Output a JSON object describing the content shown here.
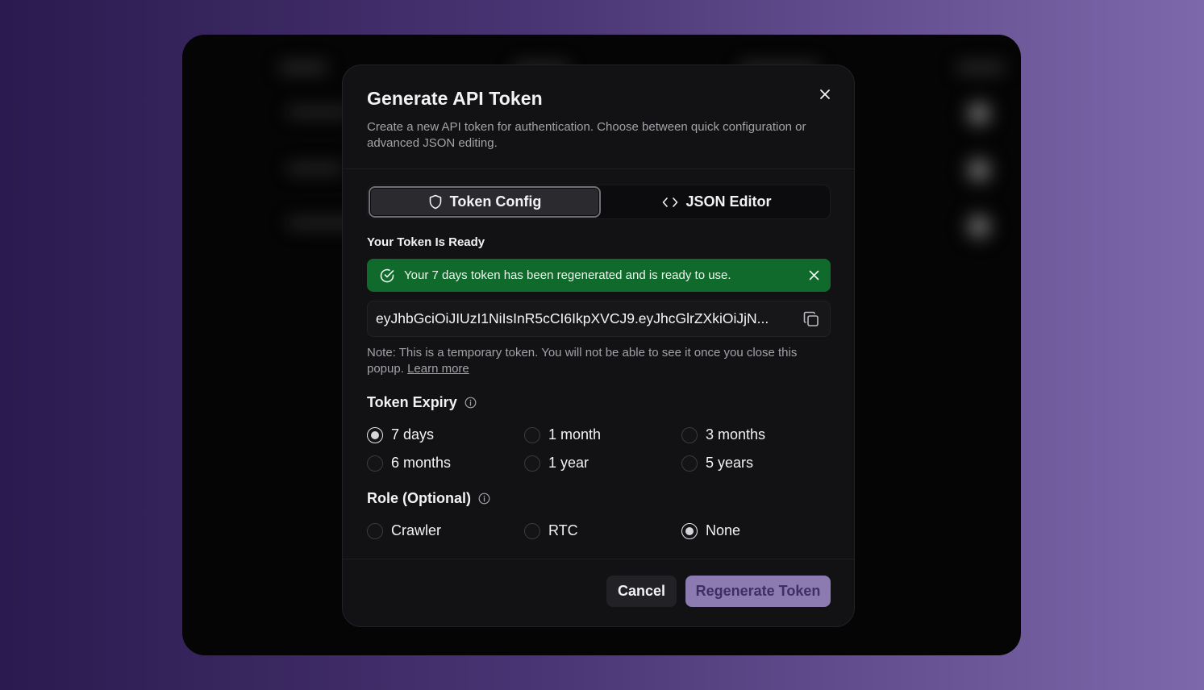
{
  "modal": {
    "title": "Generate API Token",
    "description": "Create a new API token for authentication. Choose between quick configuration or advanced JSON editing."
  },
  "tabs": [
    {
      "label": "Token Config",
      "icon": "shield-icon",
      "active": true
    },
    {
      "label": "JSON Editor",
      "icon": "code-brackets-icon",
      "active": false
    }
  ],
  "token_section": {
    "label": "Your Token Is Ready",
    "alert_message": "Your 7 days token has been regenerated and is ready to use.",
    "token_value": "eyJhbGciOiJIUzI1NiIsInR5cCI6IkpXVCJ9.eyJhcGlrZXkiOiJjN...",
    "note_text": "Note: This is a temporary token. You will not be able to see it once you close this popup.",
    "learn_more": "Learn more"
  },
  "expiry": {
    "title": "Token Expiry",
    "options": [
      "7 days",
      "1 month",
      "3 months",
      "6 months",
      "1 year",
      "5 years"
    ],
    "selected": "7 days"
  },
  "role": {
    "title": "Role (Optional)",
    "options": [
      "Crawler",
      "RTC",
      "None"
    ],
    "selected": "None"
  },
  "buttons": {
    "cancel": "Cancel",
    "regenerate": "Regenerate Token"
  },
  "colors": {
    "success": "#0f6a2b",
    "primary": "#8b7bb0",
    "primary_text": "#3e2f63"
  }
}
